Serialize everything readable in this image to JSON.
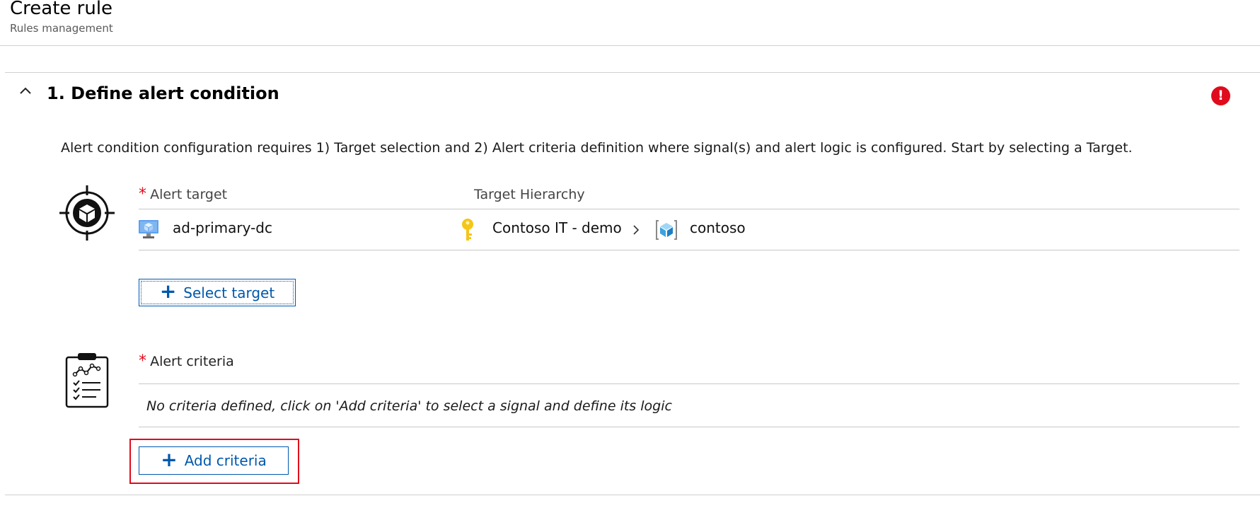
{
  "header": {
    "title": "Create rule",
    "subtitle": "Rules management"
  },
  "section": {
    "title": "1. Define alert condition",
    "error_glyph": "!",
    "description": "Alert condition configuration requires 1) Target selection and 2) Alert criteria definition where signal(s) and alert logic is configured. Start by selecting a Target."
  },
  "target": {
    "required_marker": "*",
    "label": "Alert target",
    "hierarchy_label": "Target Hierarchy",
    "resource_name": "ad-primary-dc",
    "hierarchy": [
      {
        "name": "Contoso IT - demo",
        "icon": "key-icon"
      },
      {
        "name": "contoso",
        "icon": "resource-group-icon"
      }
    ],
    "select_button": "Select target"
  },
  "criteria": {
    "required_marker": "*",
    "label": "Alert criteria",
    "empty_message": "No criteria defined, click on 'Add criteria' to select a signal and define its logic",
    "add_button": "Add criteria"
  },
  "colors": {
    "accent": "#0058ad",
    "error": "#e00b1c",
    "key": "#f5c518"
  }
}
